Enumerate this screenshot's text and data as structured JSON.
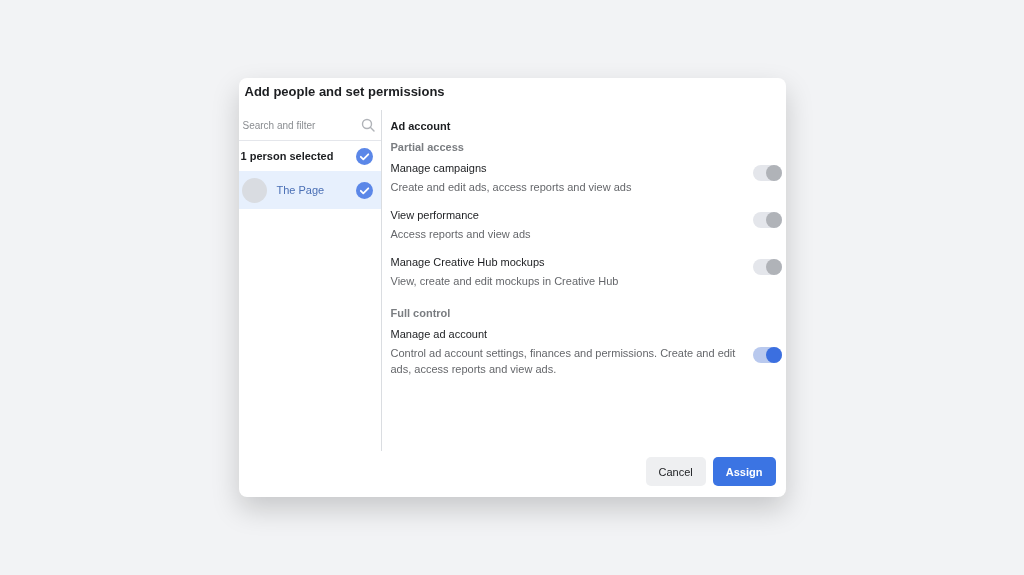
{
  "dialog": {
    "title": "Add people and set permissions"
  },
  "sidebar": {
    "search": {
      "placeholder": "Search and filter"
    },
    "summary": {
      "label": "1 person selected",
      "checked": true
    },
    "people": [
      {
        "name": "The Page",
        "selected": true,
        "checked": true
      }
    ]
  },
  "section": {
    "title": "Ad account",
    "groups": [
      {
        "title": "Partial access",
        "permissions": [
          {
            "name": "Manage campaigns",
            "description": "Create and edit ads, access reports and view ads",
            "on": true,
            "disabled": true
          },
          {
            "name": "View performance",
            "description": "Access reports and view ads",
            "on": true,
            "disabled": true
          },
          {
            "name": "Manage Creative Hub mockups",
            "description": "View, create and edit mockups in Creative Hub",
            "on": true,
            "disabled": true
          }
        ]
      },
      {
        "title": "Full control",
        "permissions": [
          {
            "name": "Manage ad account",
            "description": "Control ad account settings, finances and permissions. Create and edit ads, access reports and view ads.",
            "on": true,
            "disabled": false
          }
        ]
      }
    ]
  },
  "buttons": [
    {
      "label": "Cancel",
      "kind": "secondary"
    },
    {
      "label": "Assign",
      "kind": "primary"
    }
  ]
}
